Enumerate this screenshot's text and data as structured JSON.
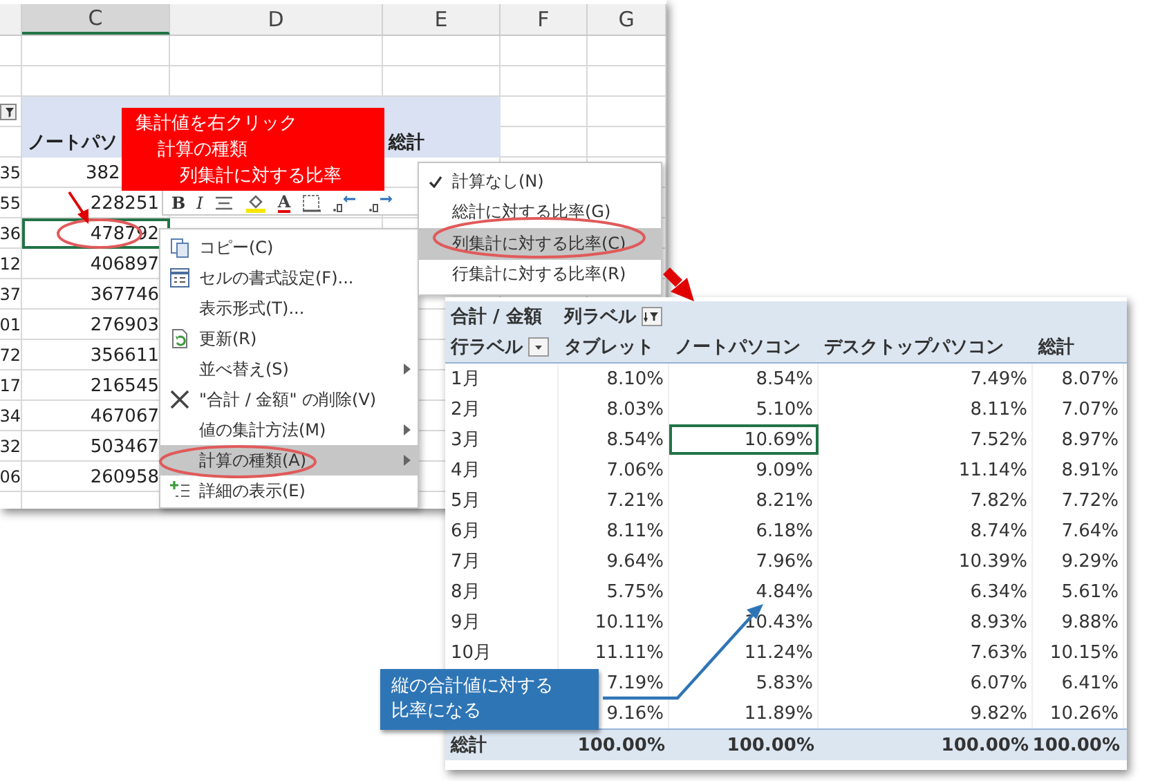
{
  "sheet": {
    "columns": [
      {
        "selected": false
      },
      {
        "label": "C",
        "selected": true
      },
      {
        "label": "D",
        "selected": false
      },
      {
        "label": "E",
        "selected": false
      },
      {
        "label": "F",
        "selected": false
      },
      {
        "label": "G",
        "selected": false
      }
    ],
    "pivot_band": {
      "column_c": "ノートパソ",
      "column_e": "総計"
    },
    "rows": [
      {
        "cells": [
          {
            "text": "35",
            "selected": false
          },
          {
            "text": "382",
            "selected": false,
            "covered": true
          }
        ]
      },
      {
        "cells": [
          {
            "text": "55",
            "selected": false
          },
          {
            "text": "228251",
            "selected": false
          }
        ]
      },
      {
        "cells": [
          {
            "text": "36",
            "selected": false
          },
          {
            "text": "478792",
            "selected": true
          }
        ]
      },
      {
        "cells": [
          {
            "text": "12",
            "selected": false
          },
          {
            "text": "406897",
            "selected": false
          }
        ]
      },
      {
        "cells": [
          {
            "text": "37",
            "selected": false
          },
          {
            "text": "367746",
            "selected": false
          }
        ]
      },
      {
        "cells": [
          {
            "text": "01",
            "selected": false
          },
          {
            "text": "276903",
            "selected": false
          }
        ]
      },
      {
        "cells": [
          {
            "text": "72",
            "selected": false
          },
          {
            "text": "356611",
            "selected": false
          }
        ]
      },
      {
        "cells": [
          {
            "text": "17",
            "selected": false
          },
          {
            "text": "216545",
            "selected": false
          }
        ]
      },
      {
        "cells": [
          {
            "text": "34",
            "selected": false
          },
          {
            "text": "467067",
            "selected": false
          }
        ]
      },
      {
        "cells": [
          {
            "text": "32",
            "selected": false
          },
          {
            "text": "503467",
            "selected": false
          }
        ]
      },
      {
        "cells": [
          {
            "text": "06",
            "selected": false
          },
          {
            "text": "260958",
            "selected": false
          }
        ]
      }
    ]
  },
  "mini_toolbar": {
    "buttons": [
      "B",
      "I",
      "A"
    ]
  },
  "context_menu": {
    "items": [
      {
        "label": "コピー(C)",
        "submenu": false,
        "selected": false
      },
      {
        "label": "セルの書式設定(F)...",
        "submenu": false,
        "selected": false
      },
      {
        "label": "表示形式(T)...",
        "submenu": false,
        "selected": false
      },
      {
        "label": "更新(R)",
        "submenu": false,
        "selected": false
      },
      {
        "label": "並べ替え(S)",
        "submenu": true,
        "selected": false
      },
      {
        "label": "\"合計 / 金額\" の削除(V)",
        "submenu": false,
        "selected": false
      },
      {
        "label": "値の集計方法(M)",
        "submenu": true,
        "selected": false
      },
      {
        "label": "計算の種類(A)",
        "submenu": true,
        "selected": true
      },
      {
        "label": "詳細の表示(E)",
        "submenu": false,
        "selected": false
      }
    ]
  },
  "submenu": {
    "items": [
      {
        "label": "計算なし(N)",
        "checked": true,
        "selected": false
      },
      {
        "label": "総計に対する比率(G)",
        "checked": false,
        "selected": false
      },
      {
        "label": "列集計に対する比率(C)",
        "checked": false,
        "selected": true
      },
      {
        "label": "行集計に対する比率(R)",
        "checked": false,
        "selected": false
      }
    ]
  },
  "instruction_callout": {
    "lines": [
      "集計値を右クリック",
      "計算の種類",
      "列集計に対する比率"
    ]
  },
  "pivot": {
    "title": "合計 / 金額",
    "column_label": "列ラベル",
    "row_label": "行ラベル",
    "columns": [
      "タブレット",
      "ノートパソコン",
      "デスクトップパソコン",
      "総計"
    ],
    "rows": [
      {
        "label": "1月",
        "values": [
          {
            "text": "8.10%",
            "selected": false
          },
          {
            "text": "8.54%",
            "selected": false
          },
          {
            "text": "7.49%",
            "selected": false
          },
          {
            "text": "8.07%",
            "selected": false
          }
        ]
      },
      {
        "label": "2月",
        "values": [
          {
            "text": "8.03%",
            "selected": false
          },
          {
            "text": "5.10%",
            "selected": false
          },
          {
            "text": "8.11%",
            "selected": false
          },
          {
            "text": "7.07%",
            "selected": false
          }
        ]
      },
      {
        "label": "3月",
        "values": [
          {
            "text": "8.54%",
            "selected": false
          },
          {
            "text": "10.69%",
            "selected": true
          },
          {
            "text": "7.52%",
            "selected": false
          },
          {
            "text": "8.97%",
            "selected": false
          }
        ]
      },
      {
        "label": "4月",
        "values": [
          {
            "text": "7.06%",
            "selected": false
          },
          {
            "text": "9.09%",
            "selected": false
          },
          {
            "text": "11.14%",
            "selected": false
          },
          {
            "text": "8.91%",
            "selected": false
          }
        ]
      },
      {
        "label": "5月",
        "values": [
          {
            "text": "7.21%",
            "selected": false
          },
          {
            "text": "8.21%",
            "selected": false
          },
          {
            "text": "7.82%",
            "selected": false
          },
          {
            "text": "7.72%",
            "selected": false
          }
        ]
      },
      {
        "label": "6月",
        "values": [
          {
            "text": "8.11%",
            "selected": false
          },
          {
            "text": "6.18%",
            "selected": false
          },
          {
            "text": "8.74%",
            "selected": false
          },
          {
            "text": "7.64%",
            "selected": false
          }
        ]
      },
      {
        "label": "7月",
        "values": [
          {
            "text": "9.64%",
            "selected": false
          },
          {
            "text": "7.96%",
            "selected": false
          },
          {
            "text": "10.39%",
            "selected": false
          },
          {
            "text": "9.29%",
            "selected": false
          }
        ]
      },
      {
        "label": "8月",
        "values": [
          {
            "text": "5.75%",
            "selected": false
          },
          {
            "text": "4.84%",
            "selected": false
          },
          {
            "text": "6.34%",
            "selected": false
          },
          {
            "text": "5.61%",
            "selected": false
          }
        ]
      },
      {
        "label": "9月",
        "values": [
          {
            "text": "10.11%",
            "selected": false
          },
          {
            "text": "10.43%",
            "selected": false
          },
          {
            "text": "8.93%",
            "selected": false
          },
          {
            "text": "9.88%",
            "selected": false
          }
        ]
      },
      {
        "label": "10月",
        "values": [
          {
            "text": "11.11%",
            "selected": false
          },
          {
            "text": "11.24%",
            "selected": false
          },
          {
            "text": "7.63%",
            "selected": false
          },
          {
            "text": "10.15%",
            "selected": false
          }
        ]
      },
      {
        "values": [
          {
            "text": "7.19%",
            "selected": false
          },
          {
            "text": "5.83%",
            "selected": false
          },
          {
            "text": "6.07%",
            "selected": false
          },
          {
            "text": "6.41%",
            "selected": false
          }
        ]
      },
      {
        "values": [
          {
            "text": "9.16%",
            "selected": false
          },
          {
            "text": "11.89%",
            "selected": false
          },
          {
            "text": "9.82%",
            "selected": false
          },
          {
            "text": "10.26%",
            "selected": false
          }
        ]
      }
    ],
    "total": {
      "label": "総計",
      "values": [
        "100.00%",
        "100.00%",
        "100.00%",
        "100.00%"
      ]
    }
  },
  "note_callout": {
    "text": "縦の合計値に対する比率になる"
  }
}
